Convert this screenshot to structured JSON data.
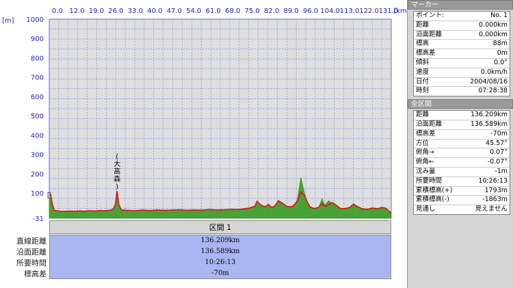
{
  "chart_data": {
    "type": "area",
    "x_unit": "[km]",
    "y_unit": "[m]",
    "x_ticks": [
      "0.0",
      "12.0",
      "19.0",
      "26.0",
      "33.0",
      "40.0",
      "47.0",
      "54.0",
      "61.0",
      "68.0",
      "75.0",
      "82.0",
      "89.0",
      "96.0",
      "104.0",
      "113.0",
      "122.0",
      "131.0"
    ],
    "y_ticks": [
      1000,
      900,
      800,
      700,
      600,
      500,
      400,
      300,
      200,
      100,
      -31
    ],
    "xlim": [
      0,
      136.589
    ],
    "ylim": [
      -31,
      1000
    ],
    "grid": true,
    "annotation": {
      "text": "(大高森)",
      "x": 27.1,
      "y": 110
    },
    "series": [
      {
        "color": "#e01010",
        "x": [
          0,
          0.6,
          1.2,
          2,
          3,
          4.5,
          6,
          8,
          10,
          12,
          14,
          16,
          18,
          20,
          22,
          24,
          25.5,
          26.4,
          27.1,
          27.8,
          28.8,
          31,
          34,
          37,
          40,
          43,
          46,
          49,
          52,
          55,
          58,
          61,
          64,
          67,
          70,
          73,
          76,
          78,
          80,
          82,
          83,
          84.5,
          86,
          87.5,
          89,
          90,
          91.5,
          93,
          95,
          97,
          99,
          100.5,
          102,
          103,
          104,
          105,
          106,
          107.5,
          109,
          110,
          111.5,
          113,
          114.5,
          116,
          117,
          118.5,
          120,
          121.5,
          123,
          125,
          127,
          129,
          131,
          133,
          134.5,
          136.589
        ],
        "y": [
          88,
          90,
          45,
          10,
          8,
          5,
          4,
          6,
          5,
          7,
          5,
          8,
          6,
          9,
          8,
          10,
          15,
          40,
          110,
          40,
          12,
          10,
          8,
          11,
          9,
          12,
          10,
          11,
          13,
          10,
          12,
          11,
          14,
          12,
          13,
          15,
          14,
          18,
          22,
          30,
          55,
          38,
          28,
          40,
          25,
          32,
          58,
          48,
          30,
          28,
          55,
          105,
          85,
          55,
          30,
          22,
          20,
          25,
          45,
          30,
          38,
          50,
          38,
          22,
          18,
          20,
          25,
          42,
          30,
          18,
          15,
          22,
          18,
          25,
          20,
          -5
        ]
      },
      {
        "color": "#3a9a22",
        "x": [
          0,
          0.6,
          1.2,
          2,
          3,
          4.5,
          6,
          8,
          10,
          12,
          14,
          16,
          18,
          20,
          22,
          24,
          25.5,
          26.4,
          27.1,
          27.8,
          28.8,
          31,
          34,
          37,
          40,
          43,
          46,
          49,
          52,
          55,
          58,
          61,
          64,
          67,
          70,
          73,
          76,
          78,
          80,
          82,
          83,
          84.5,
          86,
          87.5,
          89,
          90,
          91.5,
          93,
          95,
          97,
          99,
          100.5,
          102,
          103,
          104,
          105,
          106,
          107.5,
          109,
          110,
          111.5,
          113,
          114.5,
          116,
          117,
          118.5,
          120,
          121.5,
          123,
          125,
          127,
          129,
          131,
          133,
          134.5,
          136.589
        ],
        "y": [
          70,
          75,
          35,
          8,
          6,
          4,
          3,
          5,
          4,
          6,
          4,
          7,
          5,
          8,
          7,
          9,
          13,
          35,
          80,
          35,
          10,
          9,
          7,
          10,
          8,
          11,
          9,
          10,
          12,
          9,
          11,
          10,
          13,
          11,
          12,
          14,
          13,
          17,
          20,
          28,
          60,
          36,
          26,
          42,
          22,
          30,
          62,
          50,
          28,
          26,
          60,
          180,
          95,
          50,
          28,
          20,
          18,
          22,
          70,
          35,
          60,
          45,
          35,
          20,
          16,
          18,
          23,
          38,
          28,
          16,
          13,
          20,
          16,
          22,
          18,
          -5
        ]
      }
    ]
  },
  "segment": {
    "header": "区間 1",
    "labels": [
      "直線距離",
      "沿面距離",
      "所要時間",
      "標高差"
    ],
    "values": [
      "136.209km",
      "136.589km",
      "10:26:13",
      "-70m"
    ]
  },
  "marker": {
    "title": "マーカー",
    "rows": [
      {
        "k": "ポイント:",
        "v": "No. 1"
      },
      {
        "k": "距離",
        "v": "0.000km"
      },
      {
        "k": "沿面距離",
        "v": "0.000km"
      },
      {
        "k": "標高",
        "v": "88m"
      },
      {
        "k": "標高差",
        "v": "0m"
      },
      {
        "k": "傾斜",
        "v": "0.0°"
      },
      {
        "k": "速度",
        "v": "0.0km/h"
      },
      {
        "k": "日付",
        "v": "2004/08/16"
      },
      {
        "k": "時刻",
        "v": "07:28:38"
      }
    ]
  },
  "total": {
    "title": "全区間",
    "rows": [
      {
        "k": "距離",
        "v": "136.209km"
      },
      {
        "k": "沿面距離",
        "v": "136.589km"
      },
      {
        "k": "標高差",
        "v": "-70m"
      },
      {
        "k": "方位",
        "v": "45.57°"
      },
      {
        "k": "俯角→",
        "v": "0.07°"
      },
      {
        "k": "俯角←",
        "v": "-0.07°"
      },
      {
        "k": "沈み量",
        "v": "-1m"
      },
      {
        "k": "所要時間",
        "v": "10:26:13"
      },
      {
        "k": "累積標高(+)",
        "v": "1793m"
      },
      {
        "k": "累積標高(-)",
        "v": "-1863m"
      },
      {
        "k": "見通し",
        "v": "見えません"
      }
    ]
  }
}
